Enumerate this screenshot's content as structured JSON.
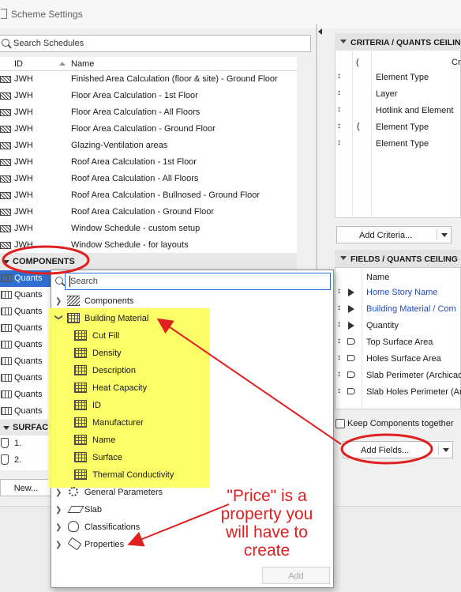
{
  "window": {
    "title": "Scheme Settings"
  },
  "search": {
    "placeholder": "Search Schedules"
  },
  "list_header": {
    "id_col": "ID",
    "name_col": "Name"
  },
  "schedules": [
    {
      "id": "JWH",
      "name": "Finished Area Calculation (floor & site) - Ground Floor"
    },
    {
      "id": "JWH",
      "name": "Floor Area Calculation - 1st Floor"
    },
    {
      "id": "JWH",
      "name": "Floor Area Calculation - All Floors"
    },
    {
      "id": "JWH",
      "name": "Floor Area Calculation - Ground Floor"
    },
    {
      "id": "JWH",
      "name": "Glazing-Ventilation areas"
    },
    {
      "id": "JWH",
      "name": "Roof Area Calculation - 1st Floor"
    },
    {
      "id": "JWH",
      "name": "Roof Area Calculation - All Floors"
    },
    {
      "id": "JWH",
      "name": "Roof Area Calculation - Bullnosed - Ground Floor"
    },
    {
      "id": "JWH",
      "name": "Roof Area Calculation - Ground Floor"
    },
    {
      "id": "JWH",
      "name": "Window Schedule - custom setup"
    },
    {
      "id": "JWH",
      "name": "Window Schedule - for layouts"
    }
  ],
  "components": {
    "header": "COMPONENTS",
    "items": [
      "Quants",
      "Quants",
      "Quants",
      "Quants",
      "Quants",
      "Quants",
      "Quants",
      "Quants",
      "Quants"
    ]
  },
  "surfaces": {
    "header": "SURFACE",
    "items": [
      "1.",
      "2."
    ]
  },
  "new_button": "New...",
  "criteria": {
    "header": "CRITERIA / QUANTS CEILING",
    "col_open": "(",
    "col_crit": "Cr",
    "rows": [
      {
        "open": "",
        "text": "Element Type"
      },
      {
        "open": "",
        "text": "Layer"
      },
      {
        "open": "",
        "text": "Hotlink and Element"
      },
      {
        "open": "(",
        "text": "Element Type"
      },
      {
        "open": "",
        "text": "Element Type"
      }
    ],
    "add_button": "Add Criteria..."
  },
  "fields": {
    "header": "FIELDS / QUANTS CEILING",
    "col_name": "Name",
    "rows": [
      {
        "text": "Home Story Name",
        "blue": true,
        "icon": "pointer-icon"
      },
      {
        "text": "Building Material / Com",
        "blue": true,
        "icon": "pointer-icon"
      },
      {
        "text": "Quantity",
        "blue": false,
        "icon": "pointer-icon"
      },
      {
        "text": "Top Surface Area",
        "blue": false,
        "icon": "surface-icon"
      },
      {
        "text": "Holes Surface Area",
        "blue": false,
        "icon": "surface-icon"
      },
      {
        "text": "Slab Perimeter (Archicad",
        "blue": false,
        "icon": "surface-icon"
      },
      {
        "text": "Slab Holes Perimeter (Ar",
        "blue": false,
        "icon": "surface-icon"
      }
    ],
    "keep_together": "Keep Components together",
    "add_button": "Add Fields..."
  },
  "popup": {
    "search_placeholder": "Search",
    "tree": {
      "components": "Components",
      "building_material": "Building Material",
      "bm_children": [
        "Cut Fill",
        "Density",
        "Description",
        "Heat Capacity",
        "ID",
        "Manufacturer",
        "Name",
        "Surface",
        "Thermal Conductivity"
      ],
      "general_parameters": "General Parameters",
      "slab": "Slab",
      "classifications": "Classifications",
      "properties": "Properties"
    },
    "add_button": "Add"
  },
  "annotation": {
    "text": "\"Price\" is a property you will have to create",
    "color": "#e02020"
  },
  "colors": {
    "highlight": "#fdfd60",
    "accent": "#2f6fcf",
    "annotation": "#e02020",
    "link_blue": "#1d4bc8"
  }
}
